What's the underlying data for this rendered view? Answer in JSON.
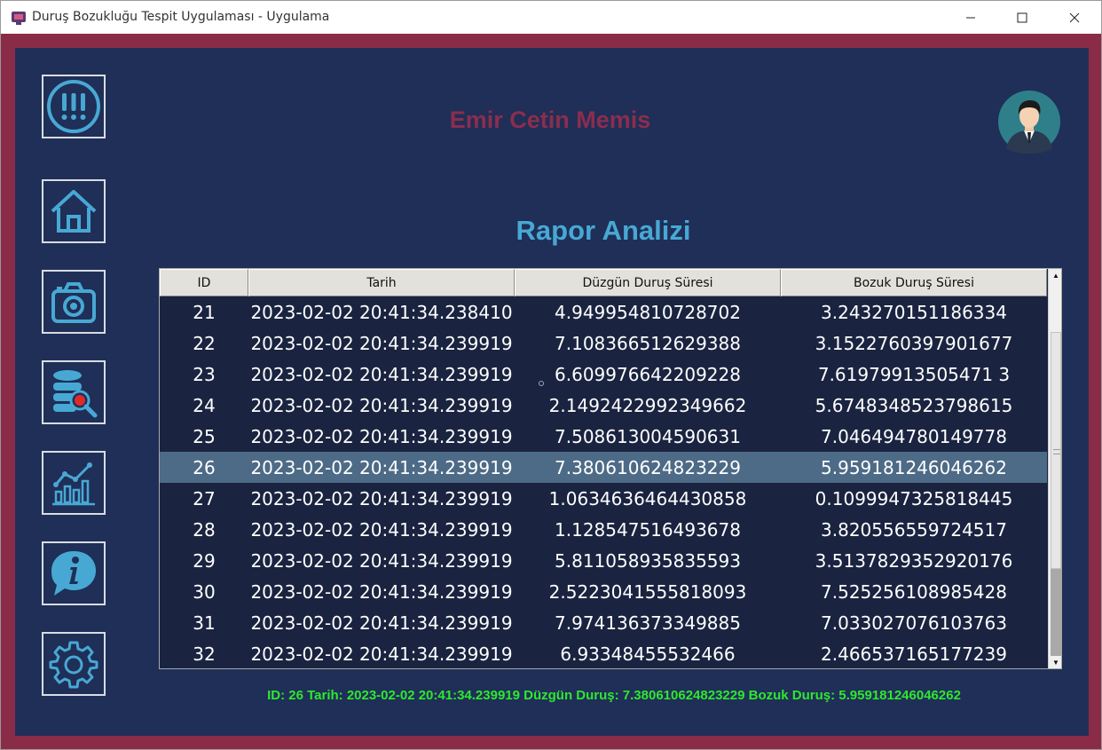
{
  "window": {
    "title": "Duruş Bozukluğu Tespit Uygulaması - Uygulama"
  },
  "colors": {
    "frame": "#8a2c48",
    "panel": "#1f2f57",
    "accent": "#48a8d4",
    "name": "#8c2d4e",
    "status": "#2ee82e",
    "selected_row": "#4d6b87"
  },
  "sidebar": {
    "items": [
      {
        "icon": "alert-icon"
      },
      {
        "icon": "home-icon"
      },
      {
        "icon": "camera-icon"
      },
      {
        "icon": "database-search-icon"
      },
      {
        "icon": "chart-icon"
      },
      {
        "icon": "info-icon"
      },
      {
        "icon": "gear-icon"
      }
    ]
  },
  "header": {
    "user_name": "Emir Cetin Memis",
    "avatar_icon": "user-avatar-icon"
  },
  "main": {
    "title": "Rapor Analizi",
    "table": {
      "columns": [
        "ID",
        "Tarih",
        "Düzgün Duruş Süresi",
        "Bozuk Duruş Süresi"
      ],
      "selected_id": "26",
      "rows": [
        [
          "21",
          "2023-02-02 20:41:34.238410",
          "4.949954810728702",
          "3.243270151186334"
        ],
        [
          "22",
          "2023-02-02 20:41:34.239919",
          "7.108366512629388",
          "3.1522760397901677"
        ],
        [
          "23",
          "2023-02-02 20:41:34.239919",
          "6.609976642209228",
          "7.61979913505471 3"
        ],
        [
          "24",
          "2023-02-02 20:41:34.239919",
          "2.1492422992349662",
          "5.6748348523798615"
        ],
        [
          "25",
          "2023-02-02 20:41:34.239919",
          "7.508613004590631",
          "7.046494780149778"
        ],
        [
          "26",
          "2023-02-02 20:41:34.239919",
          "7.380610624823229",
          "5.959181246046262"
        ],
        [
          "27",
          "2023-02-02 20:41:34.239919",
          "1.0634636464430858",
          "0.1099947325818445"
        ],
        [
          "28",
          "2023-02-02 20:41:34.239919",
          "1.128547516493678",
          "3.820556559724517"
        ],
        [
          "29",
          "2023-02-02 20:41:34.239919",
          "5.811058935835593",
          "3.5137829352920176"
        ],
        [
          "30",
          "2023-02-02 20:41:34.239919",
          "2.5223041555818093",
          "7.525256108985428"
        ],
        [
          "31",
          "2023-02-02 20:41:34.239919",
          "7.974136373349885",
          "7.033027076103763"
        ],
        [
          "32",
          "2023-02-02 20:41:34.239919",
          "6.93348455532466",
          "2.466537165177239"
        ]
      ],
      "scroll_position": 0.6,
      "visible_fraction": 0.3
    },
    "status": "ID: 26 Tarih: 2023-02-02 20:41:34.239919 Düzgün Duruş: 7.380610624823229 Bozuk Duruş: 5.959181246046262"
  }
}
